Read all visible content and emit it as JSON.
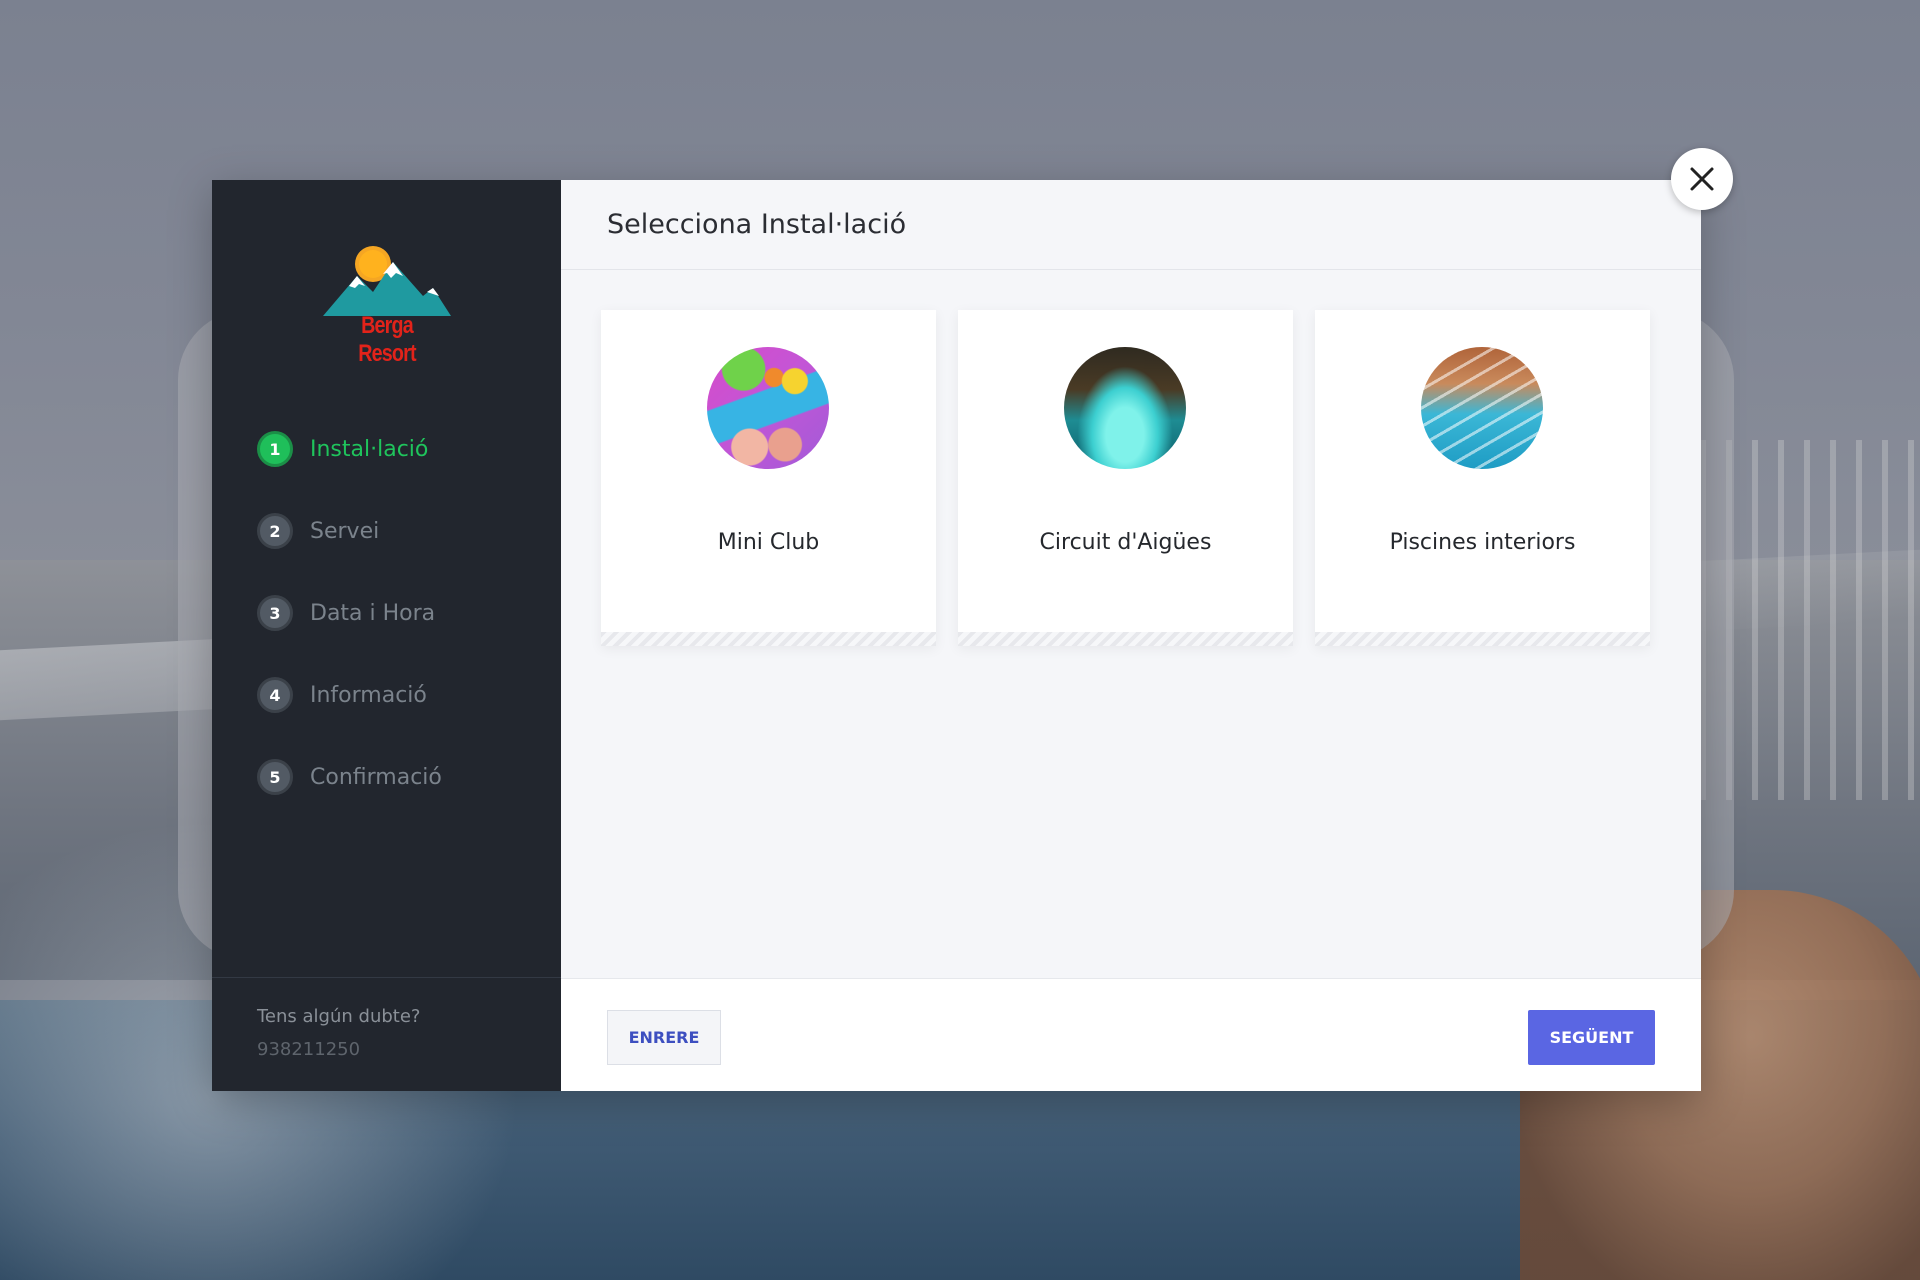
{
  "modal": {
    "title": "Selecciona Instal·lació",
    "close_icon": "close-icon"
  },
  "brand": {
    "name": "Berga Resort",
    "colors": {
      "sun": "#f5a623",
      "mountains": "#1f9aa0",
      "text": "#e2231a"
    }
  },
  "steps": [
    {
      "number": "1",
      "label": "Instal·lació",
      "active": true
    },
    {
      "number": "2",
      "label": "Servei",
      "active": false
    },
    {
      "number": "3",
      "label": "Data i Hora",
      "active": false
    },
    {
      "number": "4",
      "label": "Informació",
      "active": false
    },
    {
      "number": "5",
      "label": "Confirmació",
      "active": false
    }
  ],
  "help": {
    "question": "Tens algún dubte?",
    "phone": "938211250"
  },
  "facilities": [
    {
      "label": "Mini Club",
      "image": "mini-club-photo"
    },
    {
      "label": "Circuit d'Aigües",
      "image": "water-circuit-photo"
    },
    {
      "label": "Piscines interiors",
      "image": "indoor-pools-photo"
    }
  ],
  "footer": {
    "back_label": "ENRERE",
    "next_label": "SEGÜENT"
  },
  "colors": {
    "sidebar_bg": "#22262e",
    "active_step": "#1fc45c",
    "primary_button": "#5a66e3",
    "back_button_text": "#3d4fc0"
  }
}
